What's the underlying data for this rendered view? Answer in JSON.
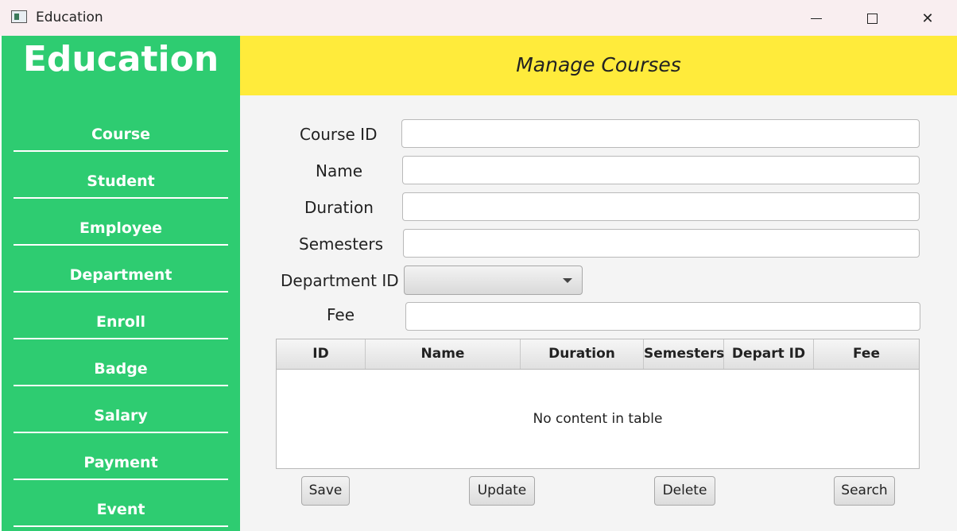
{
  "window": {
    "title": "Education"
  },
  "sidebar": {
    "brand": "Education",
    "items": [
      {
        "label": "Course"
      },
      {
        "label": "Student"
      },
      {
        "label": "Employee"
      },
      {
        "label": "Department"
      },
      {
        "label": "Enroll"
      },
      {
        "label": "Badge"
      },
      {
        "label": "Salary"
      },
      {
        "label": "Payment"
      },
      {
        "label": "Event"
      }
    ]
  },
  "header": {
    "title": "Manage Courses"
  },
  "form": {
    "course_id_label": "Course ID",
    "name_label": "Name",
    "duration_label": "Duration",
    "semesters_label": "Semesters",
    "department_id_label": "Department ID",
    "fee_label": "Fee",
    "course_id_value": "",
    "name_value": "",
    "duration_value": "",
    "semesters_value": "",
    "department_id_value": "",
    "fee_value": ""
  },
  "table": {
    "columns": [
      "ID",
      "Name",
      "Duration",
      "Semesters",
      "Depart ID",
      "Fee"
    ],
    "rows": [],
    "empty_text": "No content in table"
  },
  "buttons": {
    "save": "Save",
    "update": "Update",
    "delete": "Delete",
    "search": "Search"
  },
  "colors": {
    "sidebar": "#2ecc71",
    "header": "#ffeb3b",
    "content_bg": "#f4f4f4"
  }
}
